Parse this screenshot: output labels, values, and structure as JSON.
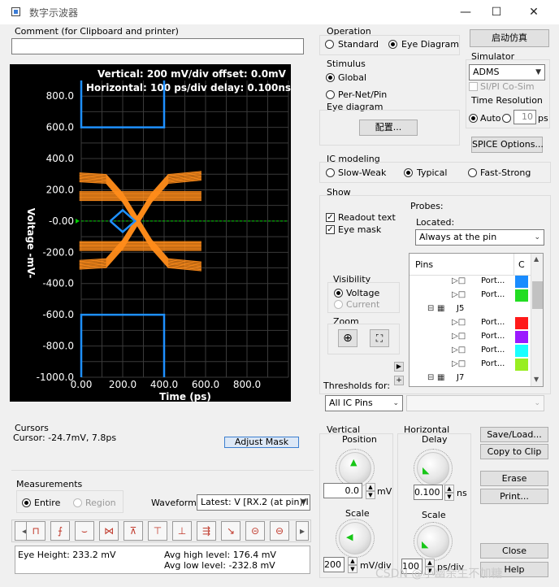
{
  "window": {
    "title": "数字示波器",
    "minimize": "—",
    "maximize": "☐",
    "close": "✕"
  },
  "comment": {
    "label": "Comment (for Clipboard and printer)",
    "value": ""
  },
  "scope": {
    "header_line1": "Vertical: 200 mV/div  offset: 0.0mV",
    "header_line2": "Horizontal: 100 ps/div  delay: 0.100nsec",
    "ylabel": "Voltage  -mV-",
    "xlabel": "Time  (ps)",
    "y_ticks": [
      "800.0",
      "600.0",
      "400.0",
      "200.0",
      "-0.00",
      "-200.0",
      "-400.0",
      "-600.0",
      "-800.0",
      "-1000.0"
    ],
    "x_ticks": [
      "0.00",
      "200.0",
      "400.0",
      "600.0",
      "800.0"
    ],
    "colors": {
      "background": "#000000",
      "grid": "#3a3a3a",
      "mask": "#1e90ff",
      "eye": "#ff8c1a",
      "center": "#00cc00"
    }
  },
  "chart_data": {
    "type": "line",
    "title": "",
    "xlabel": "Time  (ps)",
    "ylabel": "Voltage  -mV-",
    "xlim": [
      0,
      1000
    ],
    "ylim": [
      -1000,
      900
    ],
    "grid": true,
    "series": [
      {
        "values": [
          [
            -9,
            160
          ],
          [
            120,
            160
          ],
          [
            270,
            160
          ],
          [
            470,
            160
          ],
          [
            580,
            160
          ]
        ]
      },
      {
        "values": [
          [
            -9,
            -160
          ],
          [
            120,
            -160
          ],
          [
            270,
            -160
          ],
          [
            470,
            -160
          ],
          [
            580,
            -160
          ]
        ]
      },
      {
        "values": [
          [
            -9,
            280
          ],
          [
            120,
            270
          ],
          [
            200,
            150
          ],
          [
            270,
            0
          ],
          [
            340,
            -150
          ],
          [
            420,
            -270
          ],
          [
            580,
            -290
          ]
        ]
      },
      {
        "values": [
          [
            -9,
            -280
          ],
          [
            120,
            -270
          ],
          [
            200,
            -150
          ],
          [
            270,
            0
          ],
          [
            340,
            150
          ],
          [
            420,
            270
          ],
          [
            580,
            290
          ]
        ]
      }
    ],
    "masks": [
      {
        "values": [
          [
            0,
            900
          ],
          [
            0,
            600
          ],
          [
            400,
            600
          ],
          [
            400,
            900
          ]
        ]
      },
      {
        "values": [
          [
            0,
            -1000
          ],
          [
            0,
            -600
          ],
          [
            400,
            -600
          ],
          [
            400,
            -1000
          ]
        ]
      },
      {
        "values": [
          [
            140,
            0
          ],
          [
            200,
            70
          ],
          [
            260,
            0
          ],
          [
            200,
            -70
          ],
          [
            140,
            0
          ]
        ]
      }
    ]
  },
  "cursors": {
    "label": "Cursors",
    "value": "Cursor: -24.7mV, 7.8ps",
    "adjust_mask": "Adjust Mask"
  },
  "measurements": {
    "label": "Measurements",
    "entire": "Entire",
    "region": "Region",
    "waveform_label": "Waveform:",
    "waveform_value": "Latest: V [RX.2 (at pin)/I",
    "eye_height": "Eye Height: 233.2 mV",
    "avg_high": "Avg high level: 176.4 mV",
    "avg_low": "Avg low level: -232.8 mV"
  },
  "operation": {
    "label": "Operation",
    "standard": "Standard",
    "eye_diagram": "Eye Diagram",
    "run": "启动仿真"
  },
  "stimulus": {
    "label": "Stimulus",
    "global": "Global",
    "per_net": "Per-Net/Pin"
  },
  "eye_diagram": {
    "label": "Eye diagram",
    "configure": "配置..."
  },
  "simulator": {
    "label": "Simulator",
    "value": "ADMS",
    "si_pi": "SI/PI Co-Sim"
  },
  "time_resolution": {
    "label": "Time Resolution",
    "auto": "Auto",
    "value": "10",
    "unit": "ps"
  },
  "spice": {
    "label": "SPICE Options..."
  },
  "ic_modeling": {
    "label": "IC modeling",
    "slow": "Slow-Weak",
    "typical": "Typical",
    "fast": "Fast-Strong"
  },
  "show": {
    "label": "Show",
    "readout": "Readout text",
    "eye_mask": "Eye mask"
  },
  "probes": {
    "label": "Probes:",
    "located_label": "Located:",
    "located_value": "Always at the pin",
    "pins_header": "Pins",
    "col2_header": "C",
    "rows": [
      {
        "label": "Port...",
        "color": "#1a8cff"
      },
      {
        "label": "Port...",
        "color": "#22dd22"
      },
      {
        "label": "J5",
        "color": ""
      },
      {
        "label": "Port...",
        "color": "#ff1a1a"
      },
      {
        "label": "Port...",
        "color": "#9b1aff"
      },
      {
        "label": "Port...",
        "color": "#1affff"
      },
      {
        "label": "Port...",
        "color": "#99ee22"
      },
      {
        "label": "J7",
        "color": ""
      }
    ]
  },
  "visibility": {
    "label": "Visibility",
    "voltage": "Voltage",
    "current": "Current"
  },
  "zoom": {
    "label": "Zoom"
  },
  "thresholds": {
    "label": "Thresholds for:",
    "value": "All IC Pins"
  },
  "vertical": {
    "label": "Vertical",
    "position_label": "Position",
    "position_value": "0.0",
    "position_unit": "mV",
    "scale_label": "Scale",
    "scale_value": "200",
    "scale_unit": "mV/div"
  },
  "horizontal": {
    "label": "Horizontal",
    "delay_label": "Delay",
    "delay_value": "0.100",
    "delay_unit": "ns",
    "scale_label": "Scale",
    "scale_value": "100",
    "scale_unit": "ps/div"
  },
  "buttons": {
    "save_load": "Save/Load...",
    "copy_clip": "Copy to Clip",
    "erase": "Erase",
    "print": "Print...",
    "close": "Close",
    "help": "Help"
  },
  "watermark": "CSDN @小幽余生不加糖"
}
